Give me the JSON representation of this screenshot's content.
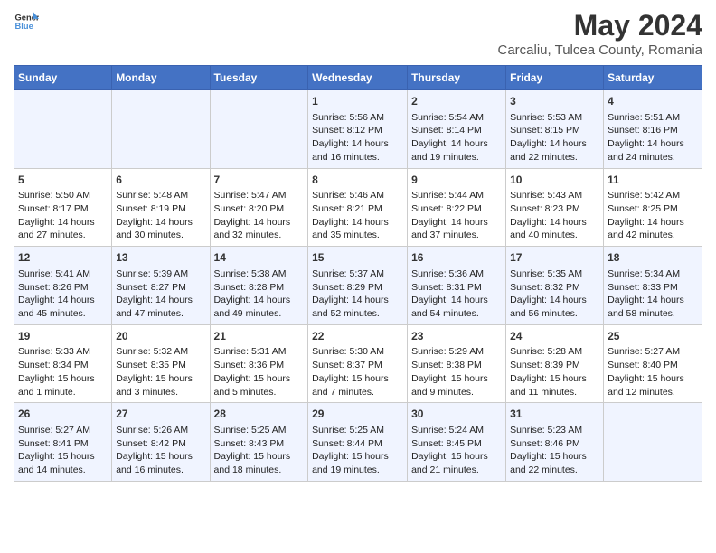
{
  "header": {
    "logo_general": "General",
    "logo_blue": "Blue",
    "title": "May 2024",
    "subtitle": "Carcaliu, Tulcea County, Romania"
  },
  "weekdays": [
    "Sunday",
    "Monday",
    "Tuesday",
    "Wednesday",
    "Thursday",
    "Friday",
    "Saturday"
  ],
  "weeks": [
    [
      {
        "day": "",
        "content": ""
      },
      {
        "day": "",
        "content": ""
      },
      {
        "day": "",
        "content": ""
      },
      {
        "day": "1",
        "content": "Sunrise: 5:56 AM\nSunset: 8:12 PM\nDaylight: 14 hours and 16 minutes."
      },
      {
        "day": "2",
        "content": "Sunrise: 5:54 AM\nSunset: 8:14 PM\nDaylight: 14 hours and 19 minutes."
      },
      {
        "day": "3",
        "content": "Sunrise: 5:53 AM\nSunset: 8:15 PM\nDaylight: 14 hours and 22 minutes."
      },
      {
        "day": "4",
        "content": "Sunrise: 5:51 AM\nSunset: 8:16 PM\nDaylight: 14 hours and 24 minutes."
      }
    ],
    [
      {
        "day": "5",
        "content": "Sunrise: 5:50 AM\nSunset: 8:17 PM\nDaylight: 14 hours and 27 minutes."
      },
      {
        "day": "6",
        "content": "Sunrise: 5:48 AM\nSunset: 8:19 PM\nDaylight: 14 hours and 30 minutes."
      },
      {
        "day": "7",
        "content": "Sunrise: 5:47 AM\nSunset: 8:20 PM\nDaylight: 14 hours and 32 minutes."
      },
      {
        "day": "8",
        "content": "Sunrise: 5:46 AM\nSunset: 8:21 PM\nDaylight: 14 hours and 35 minutes."
      },
      {
        "day": "9",
        "content": "Sunrise: 5:44 AM\nSunset: 8:22 PM\nDaylight: 14 hours and 37 minutes."
      },
      {
        "day": "10",
        "content": "Sunrise: 5:43 AM\nSunset: 8:23 PM\nDaylight: 14 hours and 40 minutes."
      },
      {
        "day": "11",
        "content": "Sunrise: 5:42 AM\nSunset: 8:25 PM\nDaylight: 14 hours and 42 minutes."
      }
    ],
    [
      {
        "day": "12",
        "content": "Sunrise: 5:41 AM\nSunset: 8:26 PM\nDaylight: 14 hours and 45 minutes."
      },
      {
        "day": "13",
        "content": "Sunrise: 5:39 AM\nSunset: 8:27 PM\nDaylight: 14 hours and 47 minutes."
      },
      {
        "day": "14",
        "content": "Sunrise: 5:38 AM\nSunset: 8:28 PM\nDaylight: 14 hours and 49 minutes."
      },
      {
        "day": "15",
        "content": "Sunrise: 5:37 AM\nSunset: 8:29 PM\nDaylight: 14 hours and 52 minutes."
      },
      {
        "day": "16",
        "content": "Sunrise: 5:36 AM\nSunset: 8:31 PM\nDaylight: 14 hours and 54 minutes."
      },
      {
        "day": "17",
        "content": "Sunrise: 5:35 AM\nSunset: 8:32 PM\nDaylight: 14 hours and 56 minutes."
      },
      {
        "day": "18",
        "content": "Sunrise: 5:34 AM\nSunset: 8:33 PM\nDaylight: 14 hours and 58 minutes."
      }
    ],
    [
      {
        "day": "19",
        "content": "Sunrise: 5:33 AM\nSunset: 8:34 PM\nDaylight: 15 hours and 1 minute."
      },
      {
        "day": "20",
        "content": "Sunrise: 5:32 AM\nSunset: 8:35 PM\nDaylight: 15 hours and 3 minutes."
      },
      {
        "day": "21",
        "content": "Sunrise: 5:31 AM\nSunset: 8:36 PM\nDaylight: 15 hours and 5 minutes."
      },
      {
        "day": "22",
        "content": "Sunrise: 5:30 AM\nSunset: 8:37 PM\nDaylight: 15 hours and 7 minutes."
      },
      {
        "day": "23",
        "content": "Sunrise: 5:29 AM\nSunset: 8:38 PM\nDaylight: 15 hours and 9 minutes."
      },
      {
        "day": "24",
        "content": "Sunrise: 5:28 AM\nSunset: 8:39 PM\nDaylight: 15 hours and 11 minutes."
      },
      {
        "day": "25",
        "content": "Sunrise: 5:27 AM\nSunset: 8:40 PM\nDaylight: 15 hours and 12 minutes."
      }
    ],
    [
      {
        "day": "26",
        "content": "Sunrise: 5:27 AM\nSunset: 8:41 PM\nDaylight: 15 hours and 14 minutes."
      },
      {
        "day": "27",
        "content": "Sunrise: 5:26 AM\nSunset: 8:42 PM\nDaylight: 15 hours and 16 minutes."
      },
      {
        "day": "28",
        "content": "Sunrise: 5:25 AM\nSunset: 8:43 PM\nDaylight: 15 hours and 18 minutes."
      },
      {
        "day": "29",
        "content": "Sunrise: 5:25 AM\nSunset: 8:44 PM\nDaylight: 15 hours and 19 minutes."
      },
      {
        "day": "30",
        "content": "Sunrise: 5:24 AM\nSunset: 8:45 PM\nDaylight: 15 hours and 21 minutes."
      },
      {
        "day": "31",
        "content": "Sunrise: 5:23 AM\nSunset: 8:46 PM\nDaylight: 15 hours and 22 minutes."
      },
      {
        "day": "",
        "content": ""
      }
    ]
  ]
}
